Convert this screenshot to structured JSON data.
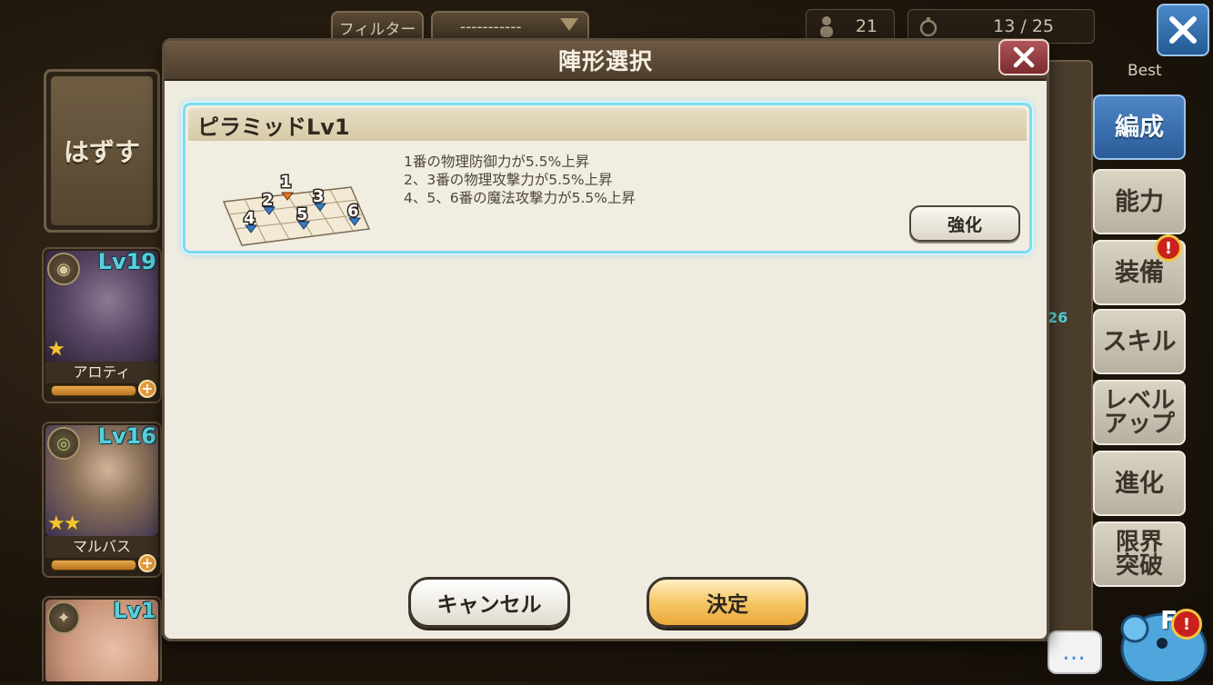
{
  "top_bar": {
    "filter_label": "フィルター",
    "sort_value": "-----------",
    "unit_count": "21",
    "capacity": "13 / 25",
    "best_label": "Best"
  },
  "left_panel": {
    "unequip_label": "はずす",
    "characters": [
      {
        "name": "アロティ",
        "level": "Lv19",
        "stars": "★",
        "portrait_color": "#6a5874"
      },
      {
        "name": "マルバス",
        "level": "Lv16",
        "stars": "★★",
        "portrait_color": "#7a6a56"
      },
      {
        "name": "",
        "level": "Lv1",
        "stars": "",
        "portrait_color": "#d6a890"
      }
    ]
  },
  "background_peek": {
    "level_fragment": "26"
  },
  "right_menu": {
    "items": [
      {
        "label": "編成",
        "active": true
      },
      {
        "label": "能力",
        "active": false
      },
      {
        "label": "装備",
        "active": false,
        "alert": true
      },
      {
        "label": "スキル",
        "active": false
      },
      {
        "label": "レベル\nアップ",
        "active": false
      },
      {
        "label": "進化",
        "active": false
      },
      {
        "label": "限界\n突破",
        "active": false
      }
    ],
    "chat_icon": "…",
    "mascot_label": "F"
  },
  "dialog": {
    "title": "陣形選択",
    "formation": {
      "name": "ピラミッドLv1",
      "effects": [
        "1番の物理防御力が5.5%上昇",
        "2、3番の物理攻撃力が5.5%上昇",
        "4、5、6番の魔法攻撃力が5.5%上昇"
      ],
      "slot_numbers": [
        "1",
        "2",
        "3",
        "4",
        "5",
        "6"
      ],
      "upgrade_label": "強化"
    },
    "cancel_label": "キャンセル",
    "confirm_label": "決定"
  },
  "colors": {
    "accent_blue": "#2a5c98",
    "highlight_cyan": "#7fdcf0",
    "confirm_gold": "#f6c767",
    "alert_red": "#c9221c",
    "level_teal": "#59d0dc"
  }
}
